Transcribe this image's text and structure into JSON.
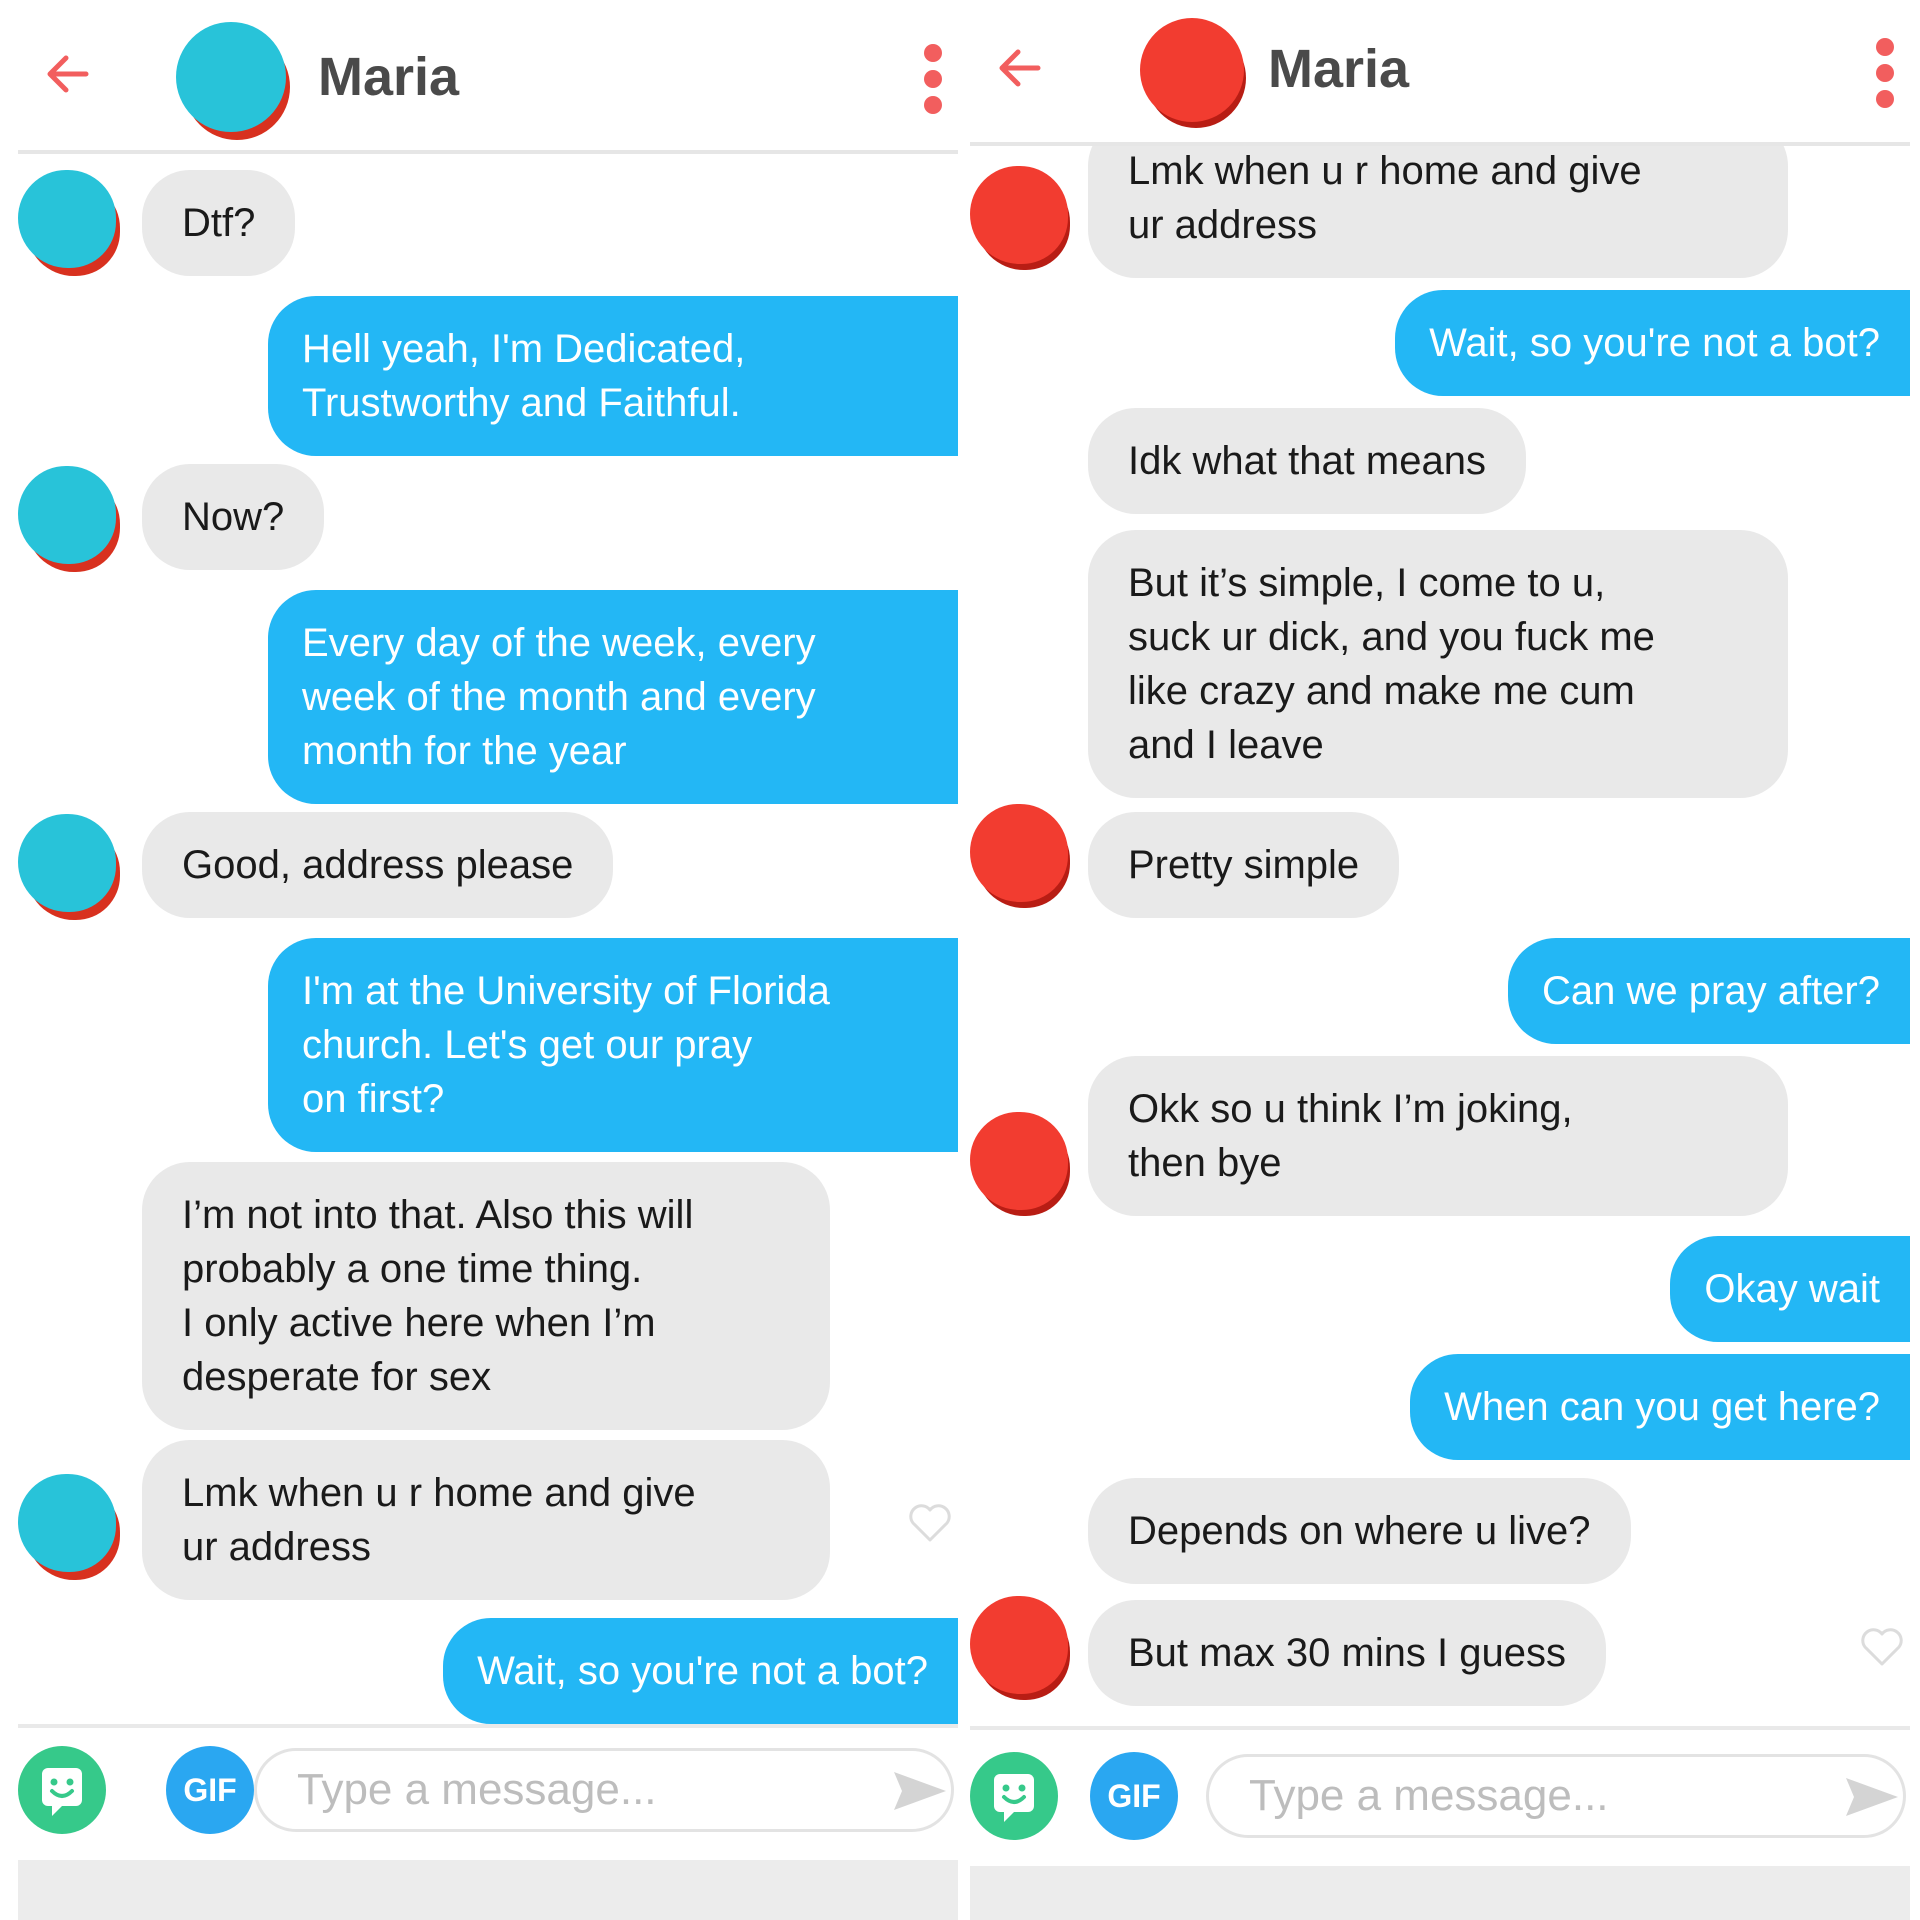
{
  "left": {
    "header": {
      "name": "Maria"
    },
    "messages": [
      {
        "dir": "in",
        "text": "Dtf?"
      },
      {
        "dir": "out",
        "text": "Hell yeah, I'm Dedicated,\nTrustworthy and Faithful."
      },
      {
        "dir": "in",
        "text": "Now?"
      },
      {
        "dir": "out",
        "text": "Every day of the week, every\nweek of the month and every\nmonth for the year"
      },
      {
        "dir": "in",
        "text": "Good, address please"
      },
      {
        "dir": "out",
        "text": "I'm at the University of Florida\nchurch. Let's get our pray\non first?"
      },
      {
        "dir": "in",
        "text": "I’m not into that. Also this will\nprobably a one time thing.\nI only active here when I’m\ndesperate for sex"
      },
      {
        "dir": "in",
        "text": "Lmk when u r home and give\nur address"
      },
      {
        "dir": "out",
        "text": "Wait, so you're not a bot?"
      }
    ],
    "composer": {
      "gif": "GIF",
      "placeholder": "Type a message..."
    }
  },
  "right": {
    "header": {
      "name": "Maria"
    },
    "messages": [
      {
        "dir": "in",
        "text": "Lmk when u r home and give\nur address"
      },
      {
        "dir": "out",
        "text": "Wait, so you're not a bot?"
      },
      {
        "dir": "in",
        "text": "Idk what that means"
      },
      {
        "dir": "in",
        "text": "But it’s simple, I come to u,\nsuck ur dick, and you fuck me\nlike crazy and make me cum\nand I leave"
      },
      {
        "dir": "in",
        "text": "Pretty simple"
      },
      {
        "dir": "out",
        "text": "Can we pray after?"
      },
      {
        "dir": "in",
        "text": "Okk so u think I’m joking,\nthen bye"
      },
      {
        "dir": "out",
        "text": "Okay wait"
      },
      {
        "dir": "out",
        "text": "When can you get here?"
      },
      {
        "dir": "in",
        "text": "Depends on where u live?"
      },
      {
        "dir": "in",
        "text": "But max 30 mins I guess"
      }
    ],
    "composer": {
      "gif": "GIF",
      "placeholder": "Type a message..."
    }
  },
  "icons": {
    "back": "arrow-left",
    "more": "vertical-dots",
    "heart": "heart-outline",
    "sticker": "smiley-sticker",
    "send": "paper-plane"
  },
  "colors": {
    "accent": "#f25e5e",
    "outgoing": "#23b7f5",
    "incoming": "#e9e9e9",
    "sticker": "#36c98a",
    "gif": "#2aa7f1"
  }
}
